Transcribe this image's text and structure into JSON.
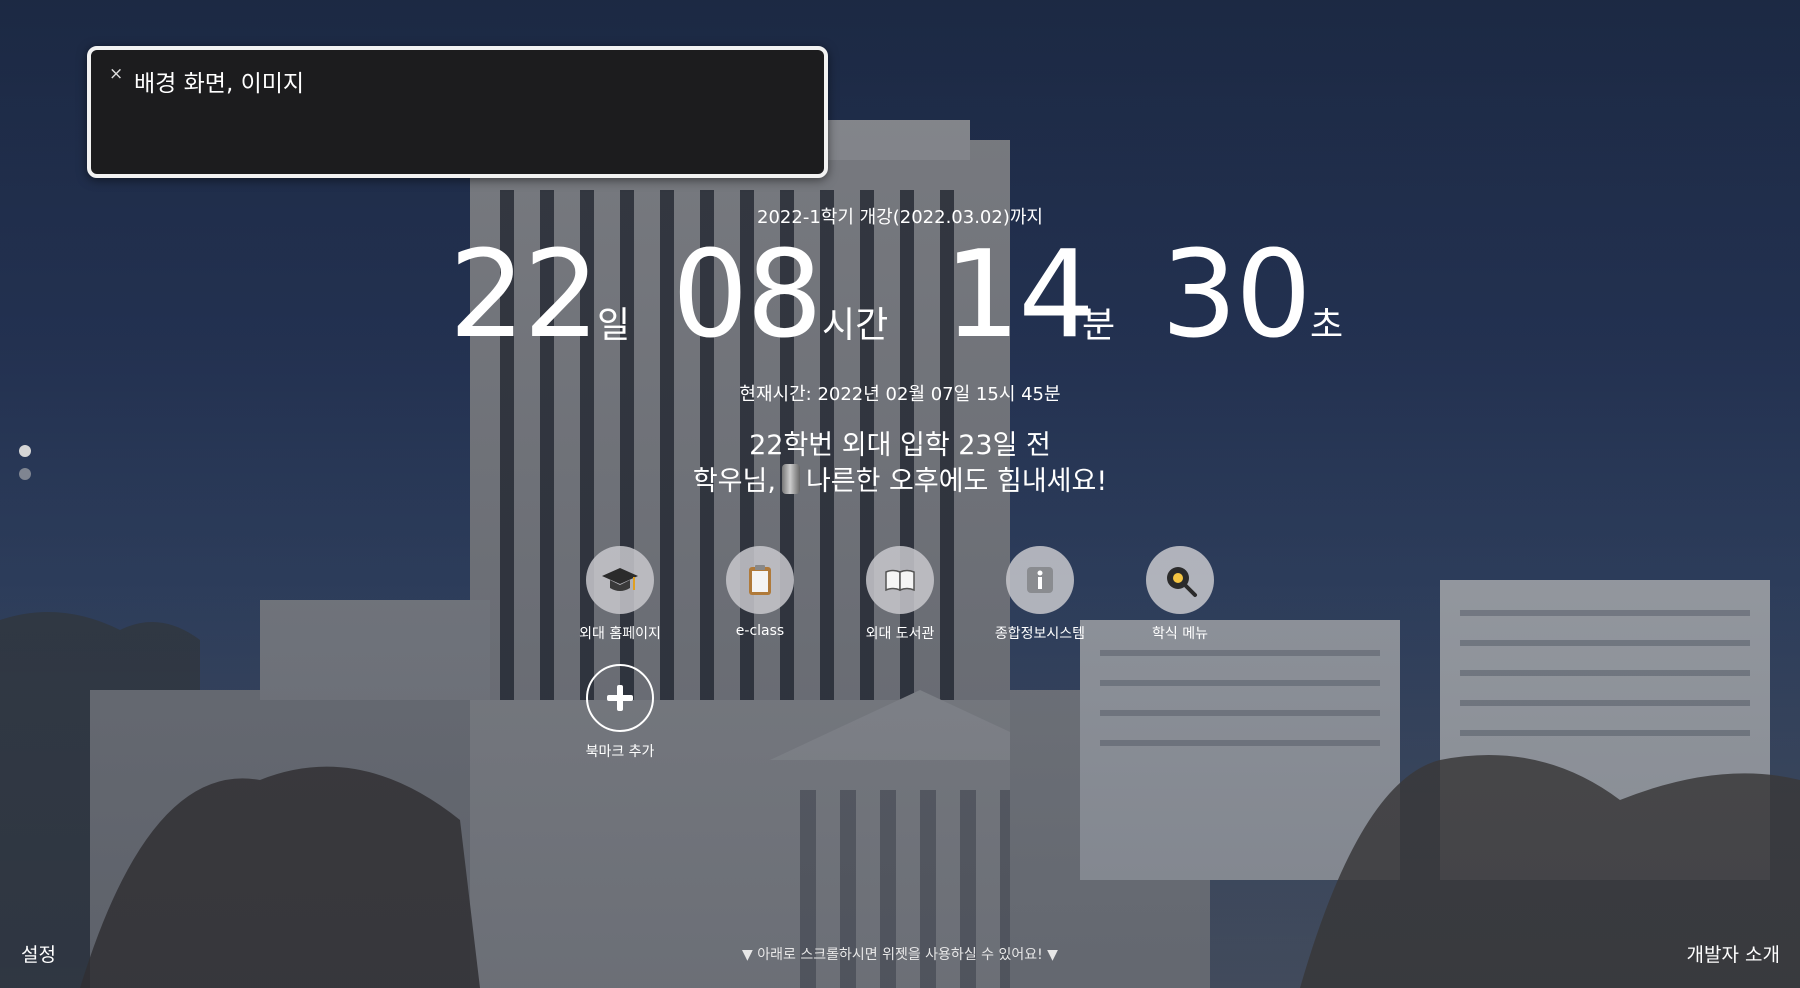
{
  "tooltip": {
    "close_symbol": "×",
    "text": "배경 화면, 이미지"
  },
  "countdown": {
    "target_text": "2022-1학기 개강(2022.03.02)까지",
    "days": "22",
    "days_unit": "일",
    "hours": "08",
    "hours_unit": "시간",
    "minutes": "14",
    "minutes_unit": "분",
    "seconds": "30",
    "seconds_unit": "초"
  },
  "current_time": "현재시간: 2022년 02월 07일 15시 45분",
  "message": {
    "line1": "22학번 외대 입학 23일 전",
    "line2_before": "학우님,",
    "line2_after": "나른한 오후에도 힘내세요!"
  },
  "bookmarks": [
    {
      "label": "외대 홈페이지",
      "icon": "graduation-cap-icon"
    },
    {
      "label": "e-class",
      "icon": "clipboard-icon"
    },
    {
      "label": "외대 도서관",
      "icon": "open-book-icon"
    },
    {
      "label": "종합정보시스템",
      "icon": "info-icon"
    },
    {
      "label": "학식 메뉴",
      "icon": "frying-pan-icon"
    }
  ],
  "add_bookmark": {
    "label": "북마크 추가",
    "icon": "plus-icon"
  },
  "footer": {
    "settings": "설정",
    "scroll_hint": "▼ 아래로 스크롤하시면 위젯을 사용하실 수 있어요! ▼",
    "developer": "개발자 소개"
  },
  "colors": {
    "tooltip_bg": "#1c1c1e",
    "tooltip_border": "#f2f2f2",
    "bookmark_circle": "#c8c8cd"
  }
}
